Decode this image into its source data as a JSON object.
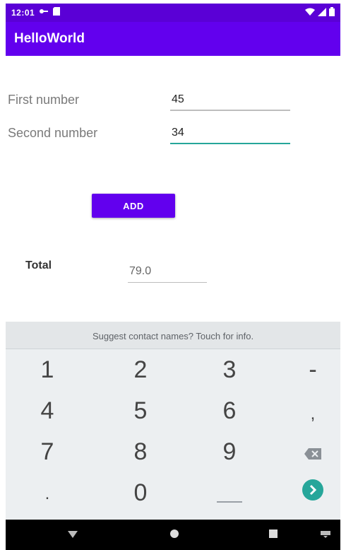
{
  "status_bar": {
    "time": "12:01"
  },
  "app_bar": {
    "title": "HelloWorld"
  },
  "form": {
    "first_label": "First number",
    "first_value": "45",
    "second_label": "Second number",
    "second_value": "34",
    "add_label": "ADD",
    "total_label": "Total",
    "total_value": "79.0"
  },
  "keyboard": {
    "suggestion": "Suggest contact names? Touch for info.",
    "keys": [
      {
        "label": "1",
        "name": "key-1"
      },
      {
        "label": "2",
        "name": "key-2"
      },
      {
        "label": "3",
        "name": "key-3"
      },
      {
        "label": "-",
        "name": "key-minus"
      },
      {
        "label": "4",
        "name": "key-4"
      },
      {
        "label": "5",
        "name": "key-5"
      },
      {
        "label": "6",
        "name": "key-6"
      },
      {
        "label": ",",
        "name": "key-comma"
      },
      {
        "label": "7",
        "name": "key-7"
      },
      {
        "label": "8",
        "name": "key-8"
      },
      {
        "label": "9",
        "name": "key-9"
      },
      {
        "label": ".",
        "name": "key-period"
      },
      {
        "label": "0",
        "name": "key-0"
      }
    ]
  },
  "colors": {
    "primary": "#6200ee",
    "status_bar": "#5a00d6",
    "focus_underline": "#26a69a",
    "keyboard_bg": "#eceff1",
    "enter_key": "#26a69a"
  },
  "icons": [
    "vpn-key-icon",
    "sd-card-icon",
    "wifi-icon",
    "signal-icon",
    "battery-icon",
    "backspace-icon",
    "enter-icon",
    "back-icon",
    "home-icon",
    "recents-icon",
    "keyboard-hide-icon"
  ]
}
